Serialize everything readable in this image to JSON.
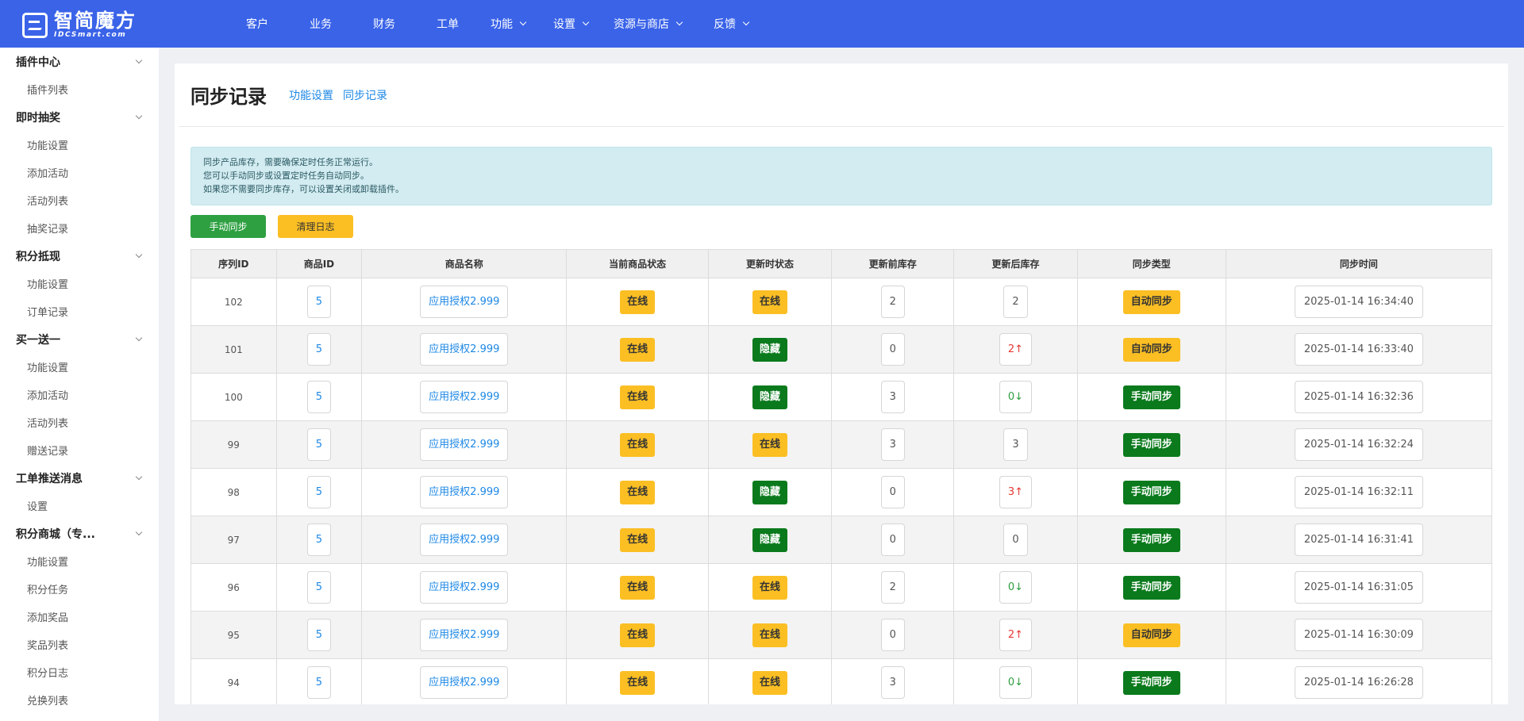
{
  "brand": {
    "name": "智简魔方",
    "sub": "IDCSmart.com"
  },
  "topnav": [
    {
      "label": "客户",
      "dropdown": false
    },
    {
      "label": "业务",
      "dropdown": false
    },
    {
      "label": "财务",
      "dropdown": false
    },
    {
      "label": "工单",
      "dropdown": false
    },
    {
      "label": "功能",
      "dropdown": true
    },
    {
      "label": "设置",
      "dropdown": true
    },
    {
      "label": "资源与商店",
      "dropdown": true
    },
    {
      "label": "反馈",
      "dropdown": true
    }
  ],
  "sidebar": [
    {
      "group": "插件中心",
      "items": [
        "插件列表"
      ]
    },
    {
      "group": "即时抽奖",
      "items": [
        "功能设置",
        "添加活动",
        "活动列表",
        "抽奖记录"
      ]
    },
    {
      "group": "积分抵现",
      "items": [
        "功能设置",
        "订单记录"
      ]
    },
    {
      "group": "买一送一",
      "items": [
        "功能设置",
        "添加活动",
        "活动列表",
        "赠送记录"
      ]
    },
    {
      "group": "工单推送消息",
      "items": [
        "设置"
      ]
    },
    {
      "group": "积分商城（专...",
      "items": [
        "功能设置",
        "积分任务",
        "添加奖品",
        "奖品列表",
        "积分日志",
        "兑换列表"
      ]
    }
  ],
  "page": {
    "title": "同步记录",
    "tabs": [
      "功能设置",
      "同步记录"
    ]
  },
  "notice": [
    "同步产品库存，需要确保定时任务正常运行。",
    "您可以手动同步或设置定时任务自动同步。",
    "如果您不需要同步库存，可以设置关闭或卸载插件。"
  ],
  "buttons": {
    "manual_sync": "手动同步",
    "clear_log": "清理日志"
  },
  "table": {
    "headers": [
      "序列ID",
      "商品ID",
      "商品名称",
      "当前商品状态",
      "更新时状态",
      "更新前库存",
      "更新后库存",
      "同步类型",
      "同步时间"
    ],
    "rows": [
      {
        "id": "102",
        "pid": "5",
        "name": "应用授权2.999",
        "cur": "在线",
        "cur_kind": "online",
        "upd": "在线",
        "upd_kind": "online",
        "before": "2",
        "after": "2",
        "after_dir": "none",
        "type": "自动同步",
        "type_kind": "auto",
        "time": "2025-01-14 16:34:40"
      },
      {
        "id": "101",
        "pid": "5",
        "name": "应用授权2.999",
        "cur": "在线",
        "cur_kind": "online",
        "upd": "隐藏",
        "upd_kind": "hidden",
        "before": "0",
        "after": "2↑",
        "after_dir": "up",
        "type": "自动同步",
        "type_kind": "auto",
        "time": "2025-01-14 16:33:40"
      },
      {
        "id": "100",
        "pid": "5",
        "name": "应用授权2.999",
        "cur": "在线",
        "cur_kind": "online",
        "upd": "隐藏",
        "upd_kind": "hidden",
        "before": "3",
        "after": "0↓",
        "after_dir": "down",
        "type": "手动同步",
        "type_kind": "manual",
        "time": "2025-01-14 16:32:36"
      },
      {
        "id": "99",
        "pid": "5",
        "name": "应用授权2.999",
        "cur": "在线",
        "cur_kind": "online",
        "upd": "在线",
        "upd_kind": "online",
        "before": "3",
        "after": "3",
        "after_dir": "none",
        "type": "手动同步",
        "type_kind": "manual",
        "time": "2025-01-14 16:32:24"
      },
      {
        "id": "98",
        "pid": "5",
        "name": "应用授权2.999",
        "cur": "在线",
        "cur_kind": "online",
        "upd": "隐藏",
        "upd_kind": "hidden",
        "before": "0",
        "after": "3↑",
        "after_dir": "up",
        "type": "手动同步",
        "type_kind": "manual",
        "time": "2025-01-14 16:32:11"
      },
      {
        "id": "97",
        "pid": "5",
        "name": "应用授权2.999",
        "cur": "在线",
        "cur_kind": "online",
        "upd": "隐藏",
        "upd_kind": "hidden",
        "before": "0",
        "after": "0",
        "after_dir": "none",
        "type": "手动同步",
        "type_kind": "manual",
        "time": "2025-01-14 16:31:41"
      },
      {
        "id": "96",
        "pid": "5",
        "name": "应用授权2.999",
        "cur": "在线",
        "cur_kind": "online",
        "upd": "在线",
        "upd_kind": "online",
        "before": "2",
        "after": "0↓",
        "after_dir": "down",
        "type": "手动同步",
        "type_kind": "manual",
        "time": "2025-01-14 16:31:05"
      },
      {
        "id": "95",
        "pid": "5",
        "name": "应用授权2.999",
        "cur": "在线",
        "cur_kind": "online",
        "upd": "在线",
        "upd_kind": "online",
        "before": "0",
        "after": "2↑",
        "after_dir": "up",
        "type": "自动同步",
        "type_kind": "auto",
        "time": "2025-01-14 16:30:09"
      },
      {
        "id": "94",
        "pid": "5",
        "name": "应用授权2.999",
        "cur": "在线",
        "cur_kind": "online",
        "upd": "在线",
        "upd_kind": "online",
        "before": "3",
        "after": "0↓",
        "after_dir": "down",
        "type": "手动同步",
        "type_kind": "manual",
        "time": "2025-01-14 16:26:28"
      }
    ]
  },
  "colors": {
    "topbar": "#3a63e8",
    "link": "#1e88e5",
    "green": "#0a7a1c",
    "yellow": "#fbbf24",
    "up": "#e53935",
    "down": "#2e9d3e"
  }
}
